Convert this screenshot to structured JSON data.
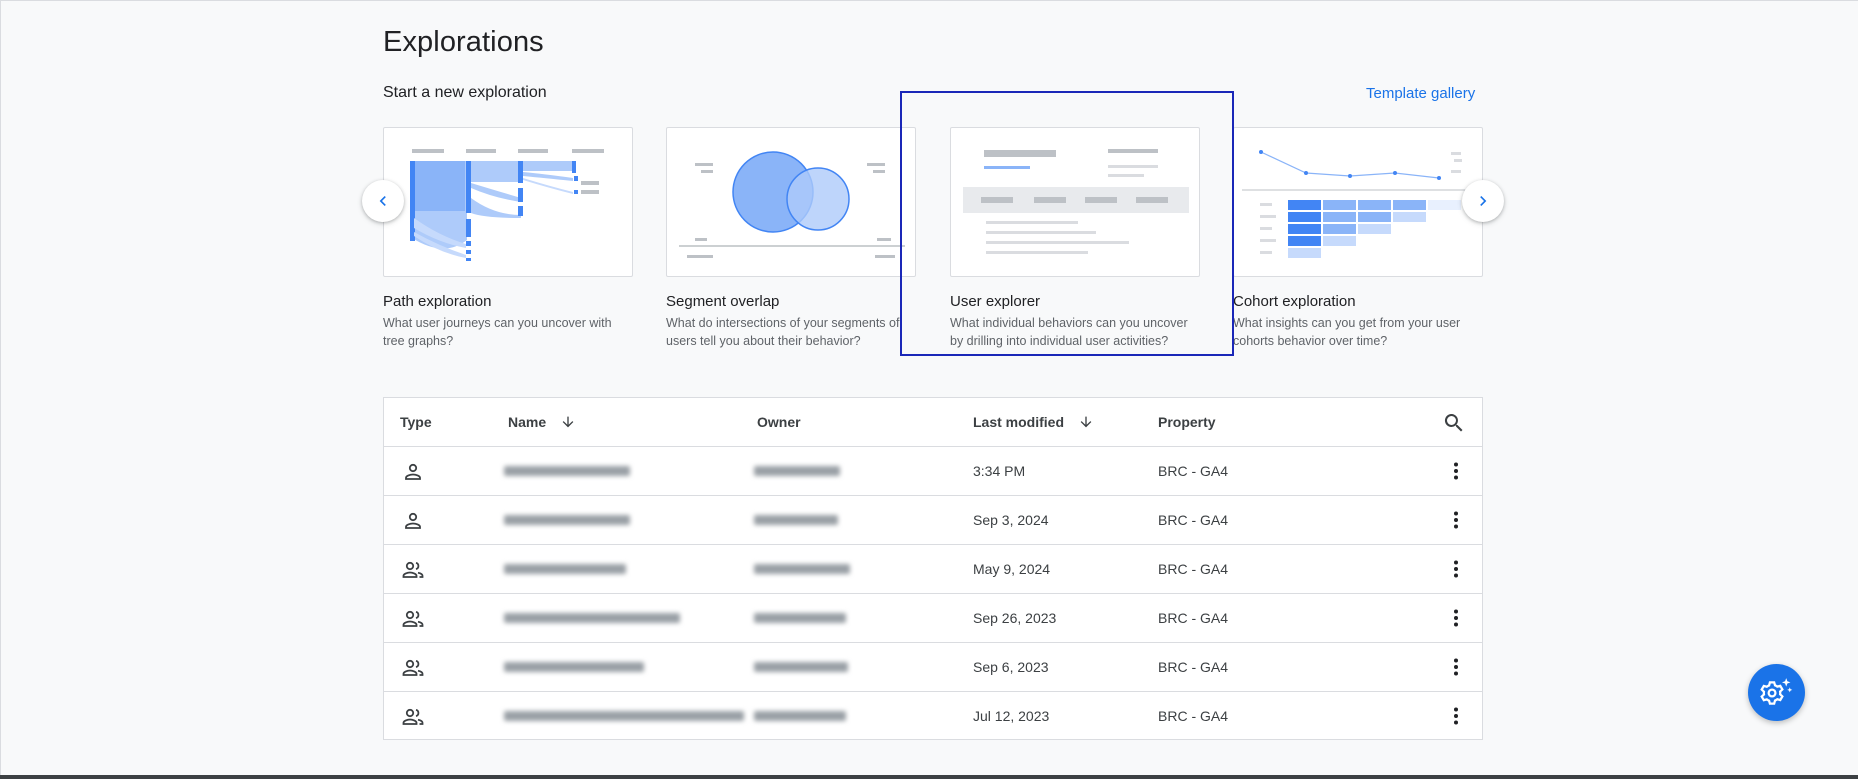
{
  "page": {
    "title": "Explorations",
    "subtitle": "Start a new exploration",
    "template_gallery": "Template gallery"
  },
  "cards": [
    {
      "title": "Path exploration",
      "desc": "What user journeys can you uncover with tree graphs?"
    },
    {
      "title": "Segment overlap",
      "desc": "What do intersections of your segments of users tell you about their behavior?"
    },
    {
      "title": "User explorer",
      "desc": "What individual behaviors can you uncover by drilling into individual user activities?"
    },
    {
      "title": "Cohort exploration",
      "desc": "What insights can you get from your user cohorts behavior over time?"
    }
  ],
  "nav": {
    "prev_icon": "chevron-left-icon",
    "next_icon": "chevron-right-icon"
  },
  "table": {
    "headers": {
      "type": "Type",
      "name": "Name",
      "owner": "Owner",
      "last_modified": "Last modified",
      "property": "Property"
    },
    "rows": [
      {
        "type_icon": "person-icon",
        "last_modified": "3:34 PM",
        "property": "BRC - GA4"
      },
      {
        "type_icon": "person-icon",
        "last_modified": "Sep 3, 2024",
        "property": "BRC - GA4"
      },
      {
        "type_icon": "group-icon",
        "last_modified": "May 9, 2024",
        "property": "BRC - GA4"
      },
      {
        "type_icon": "group-icon",
        "last_modified": "Sep 26, 2023",
        "property": "BRC - GA4"
      },
      {
        "type_icon": "group-icon",
        "last_modified": "Sep 6, 2023",
        "property": "BRC - GA4"
      },
      {
        "type_icon": "group-icon",
        "last_modified": "Jul 12, 2023",
        "property": "BRC - GA4"
      }
    ]
  },
  "colors": {
    "accent": "#1a73e8",
    "selection": "#1a27b8",
    "chart_blue": "#8ab4f8"
  }
}
